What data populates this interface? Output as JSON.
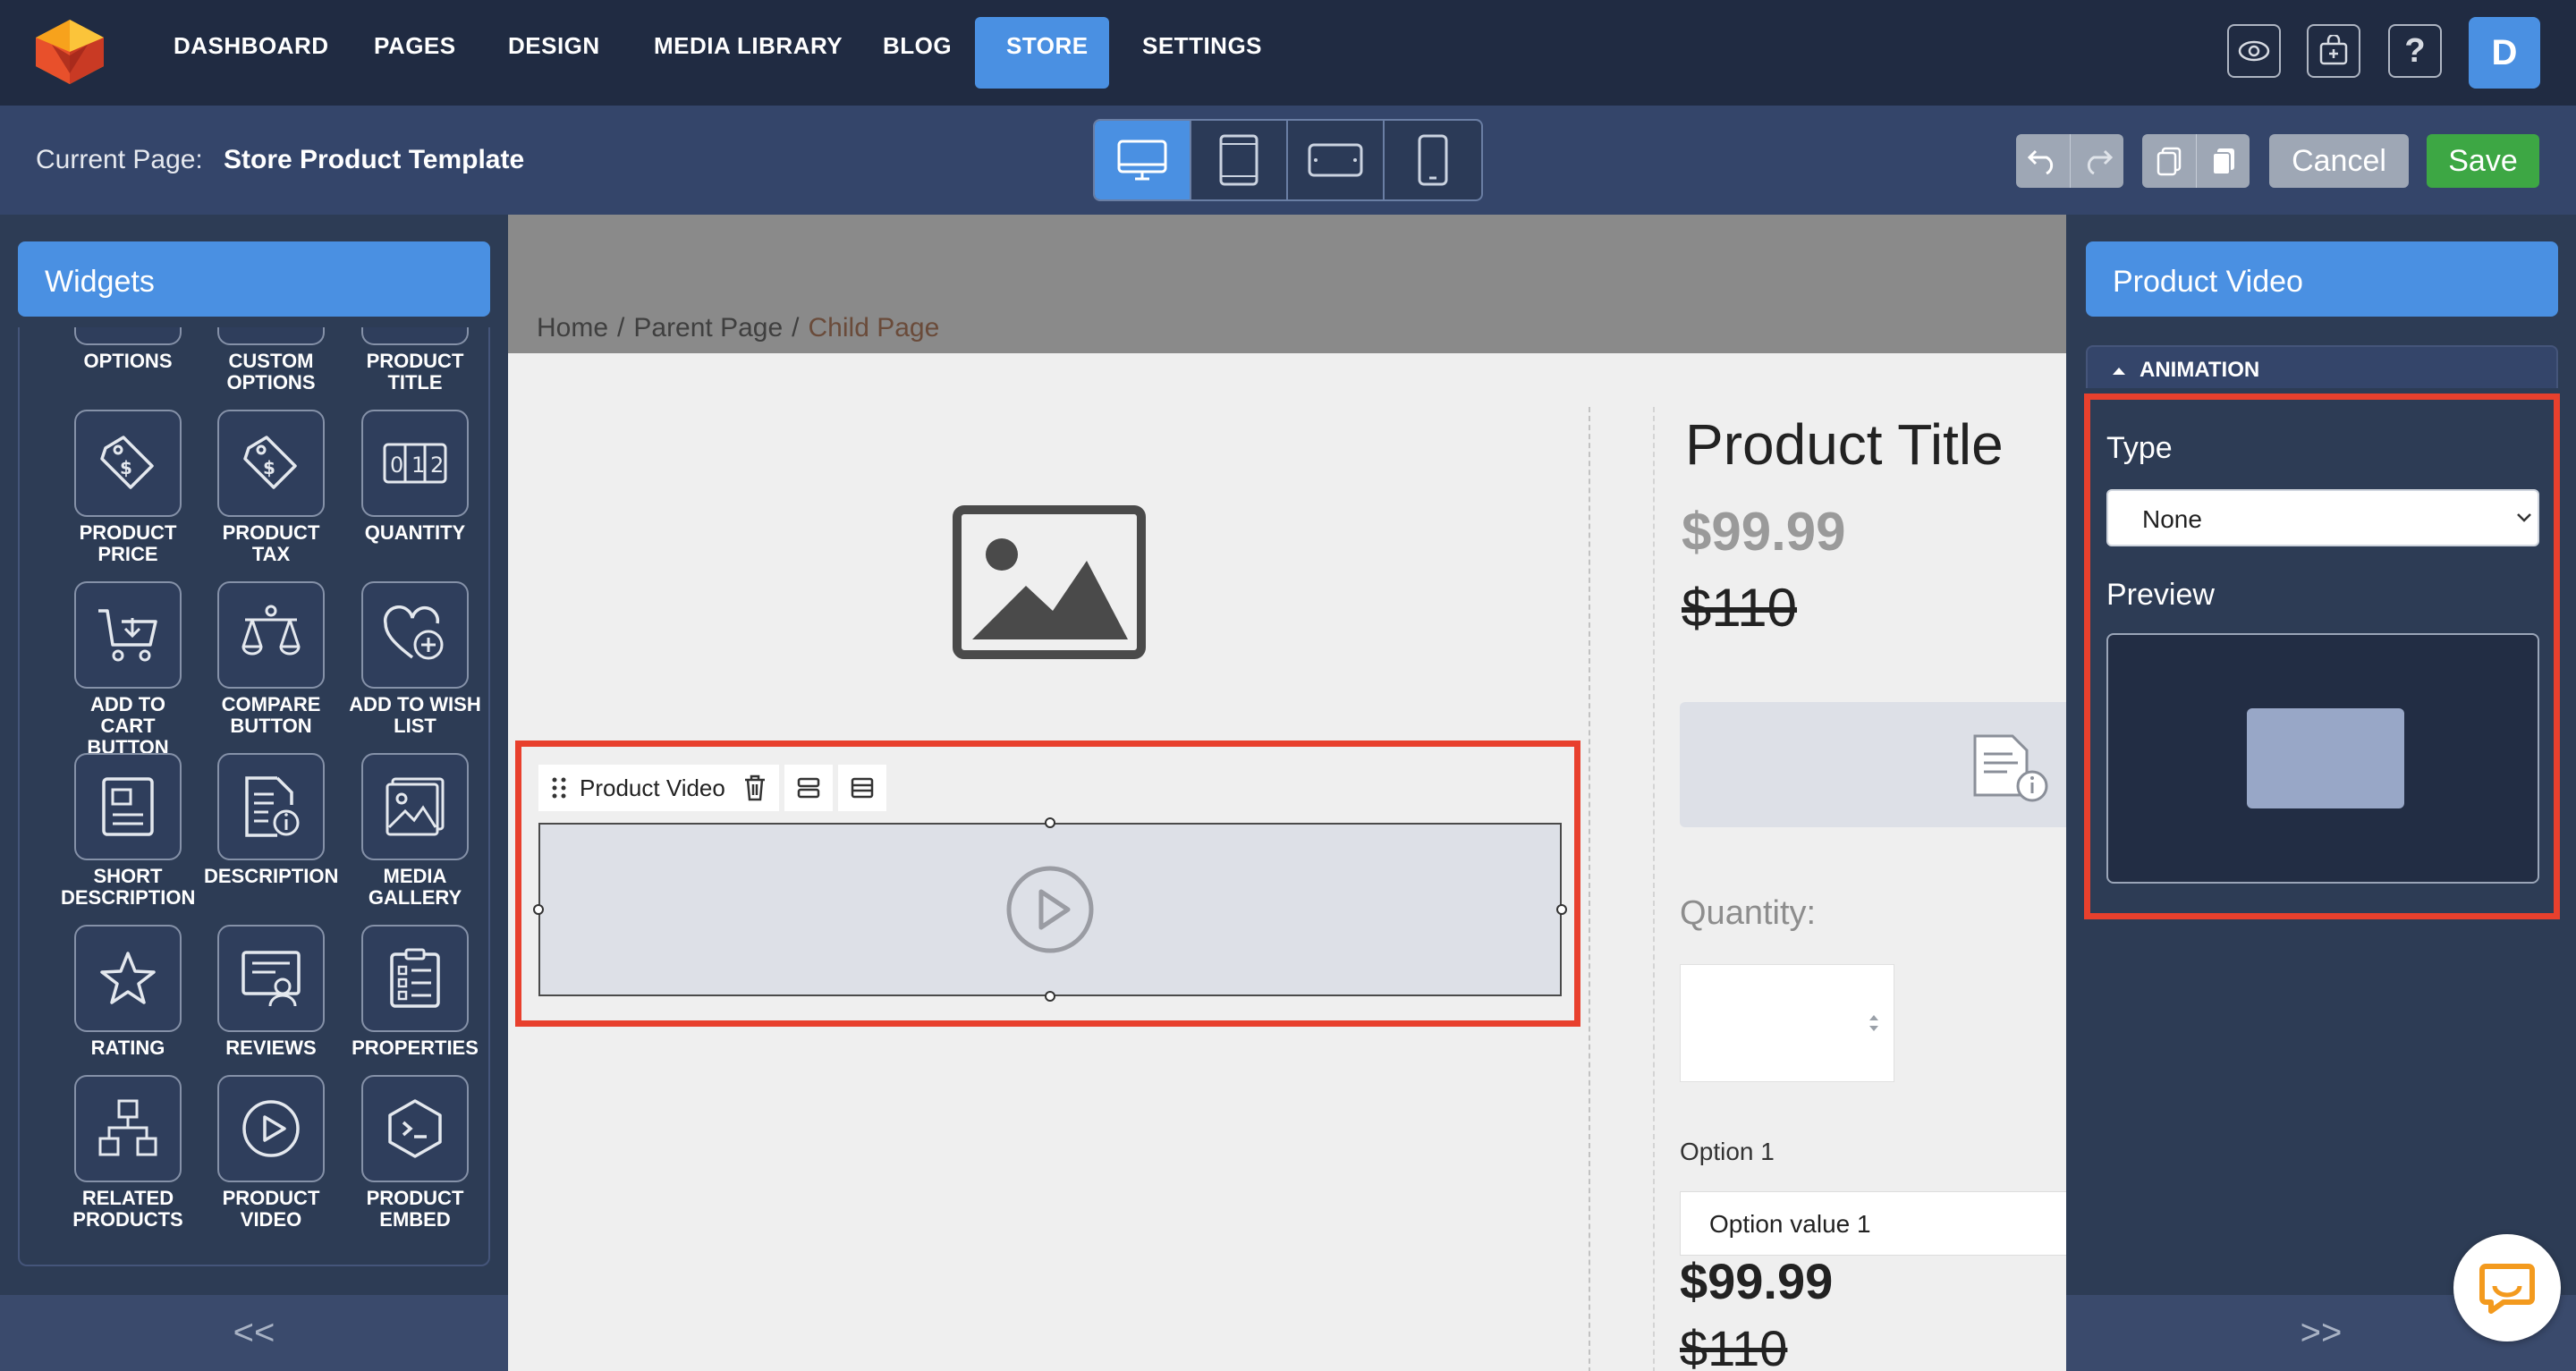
{
  "nav": {
    "items": [
      "DASHBOARD",
      "PAGES",
      "DESIGN",
      "MEDIA LIBRARY",
      "BLOG",
      "STORE",
      "SETTINGS"
    ],
    "active": "STORE",
    "icons": [
      "eye-icon",
      "store-add-icon",
      "help-icon"
    ],
    "avatar_letter": "D"
  },
  "toolbar": {
    "current_page_label": "Current Page:",
    "current_page_value": "Store Product Template",
    "devices": [
      "desktop",
      "tablet-portrait",
      "tablet-landscape",
      "mobile"
    ],
    "active_device": "desktop",
    "cancel_label": "Cancel",
    "save_label": "Save"
  },
  "left_panel": {
    "title": "Widgets",
    "widgets": [
      {
        "label": "OPTIONS",
        "icon": "options-icon"
      },
      {
        "label": "CUSTOM OPTIONS",
        "icon": "custom-options-icon"
      },
      {
        "label": "PRODUCT TITLE",
        "icon": "product-title-icon"
      },
      {
        "label": "PRODUCT PRICE",
        "icon": "price-tag-icon"
      },
      {
        "label": "PRODUCT TAX",
        "icon": "tax-tag-icon"
      },
      {
        "label": "QUANTITY",
        "icon": "quantity-icon"
      },
      {
        "label": "ADD TO CART BUTTON",
        "icon": "cart-icon"
      },
      {
        "label": "COMPARE BUTTON",
        "icon": "scale-icon"
      },
      {
        "label": "ADD TO WISH LIST",
        "icon": "heart-plus-icon"
      },
      {
        "label": "SHORT DESCRIPTION",
        "icon": "short-description-icon"
      },
      {
        "label": "DESCRIPTION",
        "icon": "description-icon"
      },
      {
        "label": "MEDIA GALLERY",
        "icon": "gallery-icon"
      },
      {
        "label": "RATING",
        "icon": "star-icon"
      },
      {
        "label": "REVIEWS",
        "icon": "reviews-icon"
      },
      {
        "label": "PROPERTIES",
        "icon": "properties-icon"
      },
      {
        "label": "RELATED PRODUCTS",
        "icon": "related-icon"
      },
      {
        "label": "PRODUCT VIDEO",
        "icon": "play-icon"
      },
      {
        "label": "PRODUCT EMBED",
        "icon": "embed-icon"
      }
    ],
    "footer": "<<"
  },
  "canvas": {
    "breadcrumbs": [
      "Home",
      "Parent Page",
      "Child Page"
    ],
    "video_widget_label": "Product Video",
    "product_title": "Product Title",
    "price": "$99.99",
    "old_price": "$110",
    "quantity_label": "Quantity:",
    "option_label": "Option 1",
    "option_value": "Option value 1",
    "price_2": "$99.99",
    "old_price_2": "$110"
  },
  "right_panel": {
    "title": "Product Video",
    "section": "ANIMATION",
    "type_label": "Type",
    "type_value": "None",
    "preview_label": "Preview",
    "footer": ">>"
  },
  "colors": {
    "nav_bg": "#202b42",
    "accent": "#4a90e2",
    "save_green": "#3da744",
    "selection_red": "#e8402d"
  }
}
